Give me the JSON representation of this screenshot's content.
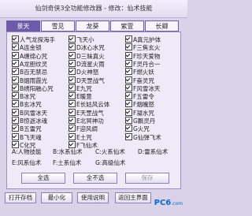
{
  "window": {
    "title": "仙剑奇侠3全功能修改器 - 修改：仙术技能"
  },
  "tabs": [
    "景天",
    "雪见",
    "龙葵",
    "紫萱",
    "长卿"
  ],
  "skills": [
    [
      "人气龙探海手",
      "飞天小",
      "A真元护体"
    ],
    [
      "A连金锁",
      "D冰心水咒",
      "F三焦玄火"
    ],
    [
      "A缠绵心咒",
      "D三昧真火",
      "F珍天爱物"
    ],
    [
      "A龙胆纹灵",
      "D流星火雨",
      "F灵丹合一"
    ],
    [
      "B百无禁忌",
      "D火神怒",
      "F燃火妖"
    ],
    [
      "B烟雨霞光",
      "D天罡战气",
      "F奋灵咒"
    ],
    [
      "B绣阳融心咒",
      "E九咒",
      "F风雪冰天"
    ],
    [
      "B冰咒",
      "E暖意",
      "F五雷令"
    ],
    [
      "B玄冰咒",
      "E长姑风云体",
      "F烟魄怒"
    ],
    [
      "B风雪冰天",
      "E天罡战气",
      "F凝水咒"
    ],
    [
      "B惊逝冰魂",
      "E北冥神功",
      "G飘灵丹"
    ],
    [
      "B五雷咒",
      "F迎风绸",
      "G火咒"
    ],
    [
      "B飞天魂",
      "E土咒",
      "G仙弹飞术"
    ],
    [
      "C化咒",
      "F飞仙术",
      ""
    ]
  ],
  "legend": {
    "row1": [
      "A:人物技能",
      "B:水系仙术",
      "C:火系仙术",
      "D:雷系仙术"
    ],
    "row2": [
      "E:风系仙术",
      "F:土系仙术",
      "G:高级仙术"
    ]
  },
  "panel_buttons": {
    "select_all": "全选",
    "deselect_all": "全不选",
    "save": "保存"
  },
  "bottom_buttons": {
    "open": "打开存档",
    "minimize": "最小化",
    "help": "使用说明",
    "back": "返回主界面"
  },
  "watermark": {
    "brand": "PC6",
    "suffix": ".com"
  },
  "colors": {
    "tab_active": "#6d5aa8",
    "accent_blue": "#0a6bd1"
  }
}
